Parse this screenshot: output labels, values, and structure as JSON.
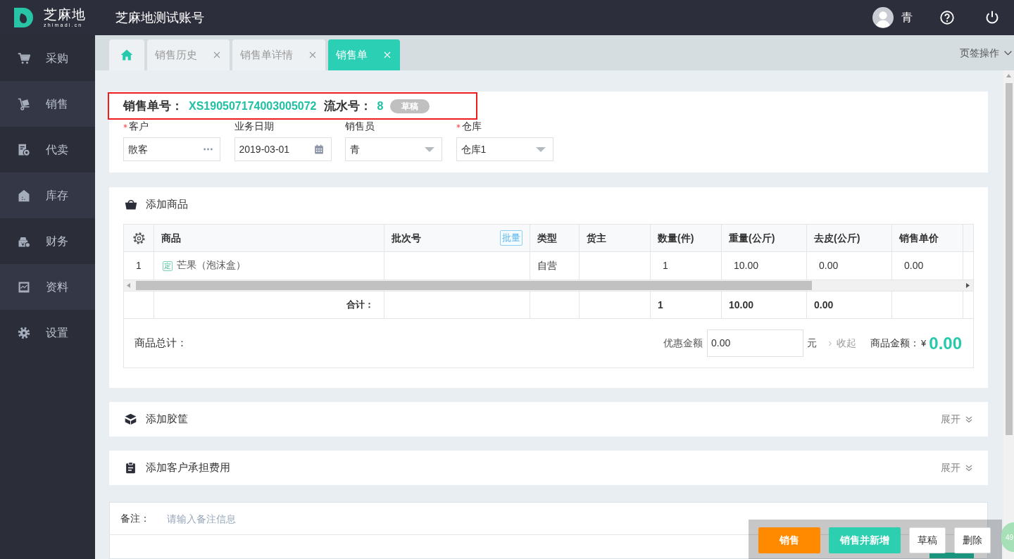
{
  "header": {
    "logo_text": "芝麻地",
    "logo_subtext": "zhimadi.cn",
    "account": "芝麻地测试账号",
    "user": "青"
  },
  "sidebar": {
    "items": [
      {
        "label": "采购"
      },
      {
        "label": "销售"
      },
      {
        "label": "代卖"
      },
      {
        "label": "库存"
      },
      {
        "label": "财务"
      },
      {
        "label": "资料"
      },
      {
        "label": "设置"
      }
    ]
  },
  "tabs": [
    {
      "kind": "home",
      "selected": false
    },
    {
      "kind": "page",
      "label": "销售历史",
      "selected": false
    },
    {
      "kind": "page",
      "label": "销售单详情",
      "selected": false
    },
    {
      "kind": "page",
      "label": "销售单",
      "selected": true
    }
  ],
  "tab_actions": "页签操作",
  "order_header": {
    "highlighted": true,
    "number_label": "销售单号：",
    "number": "XS190507174003005072",
    "serial_label": "流水号：",
    "serial": "8",
    "status": "草稿"
  },
  "fields": [
    {
      "kind": "picker",
      "label": "客户",
      "required": true,
      "value": "散客"
    },
    {
      "kind": "date",
      "label": "业务日期",
      "required": false,
      "value": "2019-03-01"
    },
    {
      "kind": "select",
      "label": "销售员",
      "required": false,
      "value": "青"
    },
    {
      "kind": "select",
      "label": "仓库",
      "required": true,
      "value": "仓库1"
    }
  ],
  "products": {
    "title": "添加商品",
    "batch_button": "批量",
    "columns": [
      "商品",
      "批次号",
      "类型",
      "货主",
      "数量(件)",
      "重量(公斤)",
      "去皮(公斤)",
      "销售单价"
    ],
    "rows": [
      {
        "index": "1",
        "tag": "定",
        "product": "芒果（泡沫盒）",
        "type": "自营",
        "quantity": "1",
        "weight": "10.00",
        "tare": "0.00",
        "unit_price": "0.00"
      }
    ],
    "totals": {
      "label": "合计：",
      "quantity": "1",
      "weight": "10.00",
      "tare": "0.00"
    },
    "summary": {
      "label": "商品总计：",
      "discount_label": "优惠金额",
      "discount_value": "0.00",
      "unit": "元",
      "collapse": "收起",
      "amount_label": "商品金额：",
      "currency": "¥",
      "amount": "0.00"
    }
  },
  "sections": [
    {
      "kind": "crates",
      "title": "添加胶筐",
      "toggle": "展开"
    },
    {
      "kind": "fees",
      "title": "添加客户承担费用",
      "toggle": "展开"
    }
  ],
  "remark": {
    "label": "备注：",
    "placeholder": "请输入备注信息"
  },
  "actions": [
    {
      "kind": "primary",
      "label": "销售"
    },
    {
      "kind": "secondary",
      "label": "销售并新增"
    },
    {
      "kind": "plain",
      "label": "草稿"
    },
    {
      "kind": "plain",
      "label": "删除"
    }
  ],
  "float_badge": "49"
}
